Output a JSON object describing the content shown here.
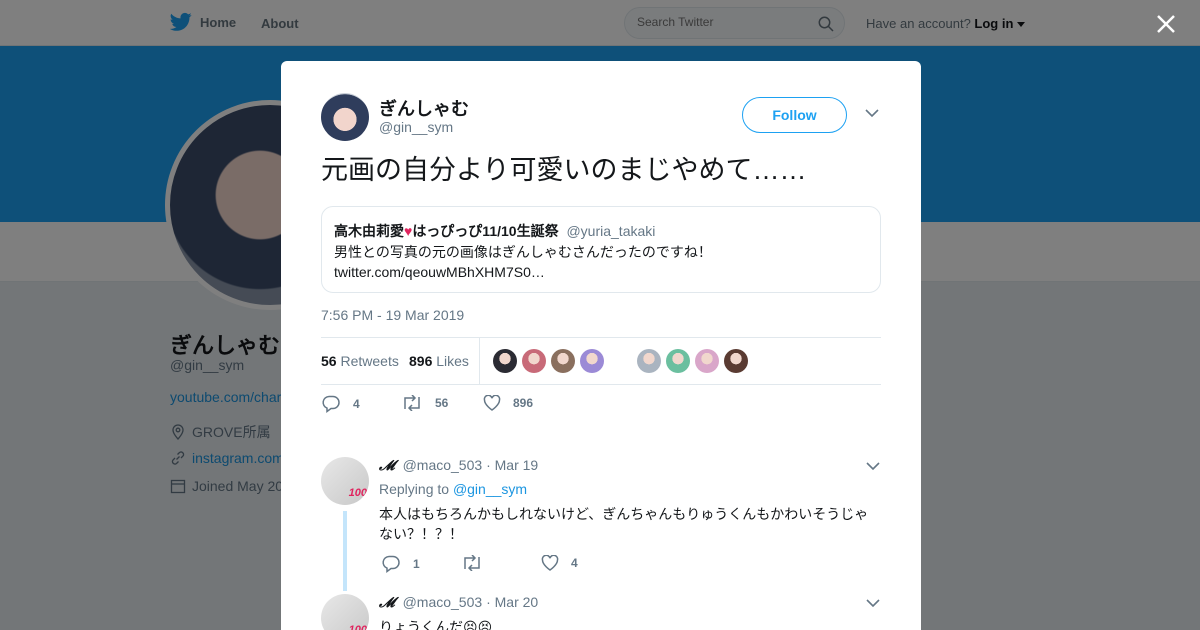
{
  "topbar": {
    "home_label": "Home",
    "about_label": "About",
    "search_placeholder": "Search Twitter",
    "account_prompt": "Have an account?",
    "login_label": "Log in"
  },
  "profile": {
    "name": "ぎんしゃむ",
    "handle": "@gin__sym",
    "link": "youtube.com/char",
    "location": "GROVE所属",
    "website": "instagram.com",
    "joined": "Joined May 20"
  },
  "tweet": {
    "author_name": "ぎんしゃむ",
    "author_handle": "@gin__sym",
    "follow_label": "Follow",
    "text": "元画の自分より可愛いのまじやめて……",
    "quote": {
      "name_prefix": "高木由莉愛",
      "name_suffix": "はっぴっぴ11/10生誕祭",
      "handle": "@yuria_takaki",
      "line1": "男性との写真の元の画像はぎんしゃむさんだったのですね！",
      "line2": "twitter.com/qeouwMBhXHM7S0…"
    },
    "timestamp": "7:56 PM - 19 Mar 2019",
    "retweets_count": "56",
    "retweets_label": "Retweets",
    "likes_count": "896",
    "likes_label": "Likes",
    "actions": {
      "replies": "4",
      "retweets": "56",
      "likes": "896"
    }
  },
  "replies": [
    {
      "display": "𝓜",
      "handle": "@maco_503",
      "date": "Mar 19",
      "replying_prefix": "Replying to",
      "replying_to": "@gin__sym",
      "text": "本人はもちろんかもしれないけど、ぎんちゃんもりゅうくんもかわいそうじゃない？！？！",
      "replies": "1",
      "likes": "4",
      "avatar_badge": "100"
    },
    {
      "display": "𝓜",
      "handle": "@maco_503",
      "date": "Mar 20",
      "text": "りょうくんだ😣😣",
      "avatar_badge": "100"
    }
  ],
  "colors": {
    "accent": "#1da1f2",
    "link": "#1b95e0",
    "like_heart": "#e0245e",
    "liker_avatars": [
      "#2b2b33",
      "#c86a78",
      "#8a6f5e",
      "#9b8ad6",
      "#aab4c0",
      "#6bbf9f",
      "#d9a6c9",
      "#5a3b32"
    ]
  },
  "separator": "·"
}
